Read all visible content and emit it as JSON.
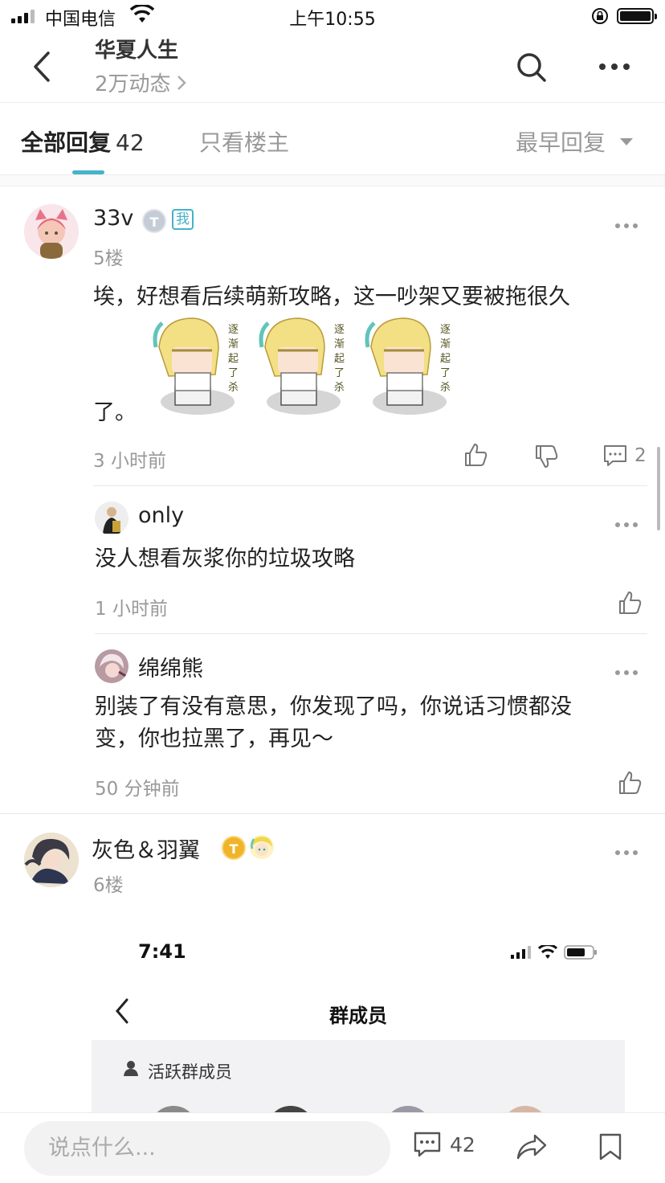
{
  "status_bar": {
    "carrier": "中国电信",
    "time": "上午10:55"
  },
  "header": {
    "title": "华夏人生",
    "subtitle": "2万动态",
    "icons": [
      "back-icon",
      "search-icon",
      "more-icon"
    ]
  },
  "tabs": {
    "all_label": "全部回复",
    "all_count": "42",
    "owner_only_label": "只看楼主",
    "sort_label": "最早回复"
  },
  "posts": [
    {
      "username": "33v",
      "badge": "T",
      "me_badge": "我",
      "floor": "5楼",
      "content_line1": "埃，好想看后续萌新攻略，这一吵架又要被拖很久",
      "content_line2": "了。",
      "time": "3 小时前",
      "reply_count": "2",
      "replies": [
        {
          "username": "only",
          "content": "没人想看灰浆你的垃圾攻略",
          "time": "1 小时前"
        },
        {
          "username": "绵绵熊",
          "content_line1": "别装了有没有意思，你发现了吗，你说话习惯都没",
          "content_line2": "变，你也拉黑了，再见～",
          "time": "50 分钟前"
        }
      ]
    },
    {
      "username": "灰色＆羽翼",
      "badge": "T",
      "floor": "6楼"
    }
  ],
  "embedded_screenshot": {
    "time": "7:41",
    "title": "群成员",
    "section_label": "活跃群成员"
  },
  "bottom_bar": {
    "input_placeholder": "说点什么...",
    "comment_count": "42"
  },
  "colors": {
    "accent": "#45b3c9",
    "gold_badge": "#f0b429",
    "muted_text": "#999999"
  }
}
